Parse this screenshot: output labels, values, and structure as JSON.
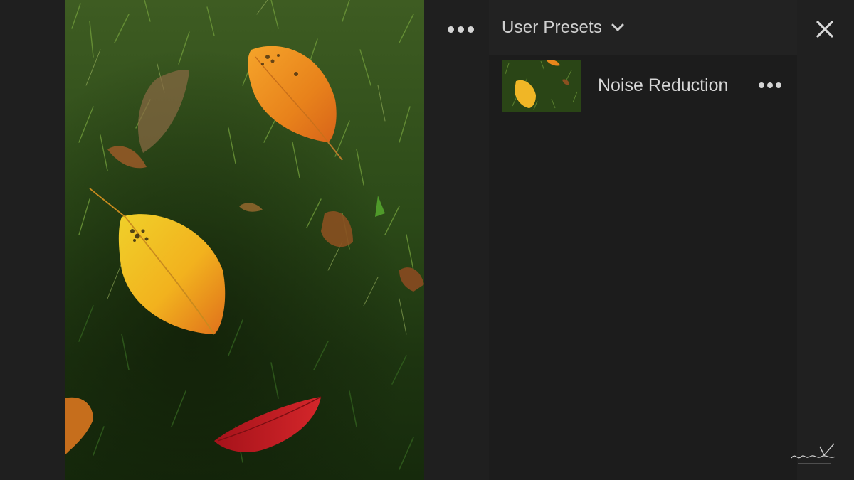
{
  "app": {
    "background": "#1f1f1f"
  },
  "canvas": {
    "more_icon": "more-horizontal-icon",
    "photo_description": "autumn leaves on green grass"
  },
  "panel": {
    "header": {
      "title": "User Presets",
      "dropdown_icon": "chevron-down-icon"
    },
    "presets": [
      {
        "name": "Noise Reduction",
        "more_icon": "more-horizontal-icon"
      }
    ]
  },
  "window": {
    "close_icon": "close-icon"
  },
  "colors": {
    "panel_bg": "#1c1c1c",
    "header_bg": "#222222",
    "text": "#cfcfcf"
  }
}
